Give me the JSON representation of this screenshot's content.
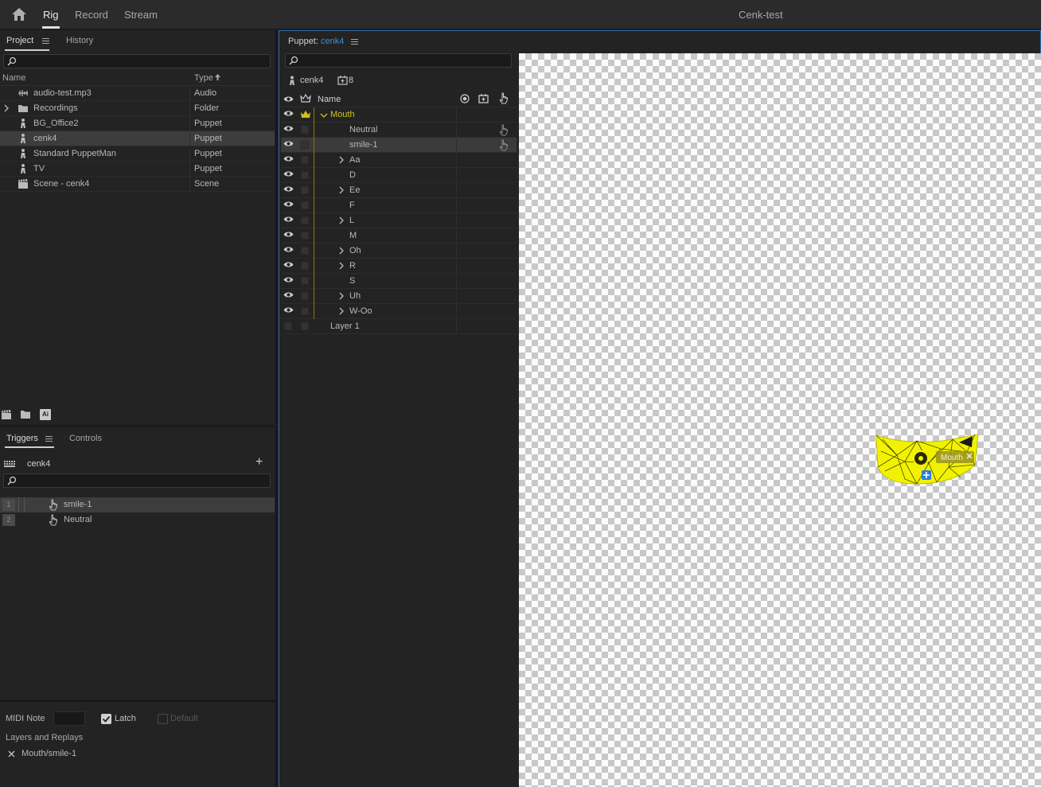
{
  "topbar": {
    "tabs": [
      "Rig",
      "Record",
      "Stream"
    ],
    "active_tab": "Rig",
    "title": "Cenk-test"
  },
  "project": {
    "tab_project": "Project",
    "tab_history": "History",
    "search_placeholder": "",
    "columns": {
      "name": "Name",
      "type": "Type"
    },
    "items": [
      {
        "name": "audio-test.mp3",
        "type": "Audio",
        "icon": "audio-icon"
      },
      {
        "name": "Recordings",
        "type": "Folder",
        "icon": "folder-icon",
        "expandable": true
      },
      {
        "name": "BG_Office2",
        "type": "Puppet",
        "icon": "puppet-icon"
      },
      {
        "name": "cenk4",
        "type": "Puppet",
        "icon": "puppet-icon",
        "selected": true
      },
      {
        "name": "Standard PuppetMan",
        "type": "Puppet",
        "icon": "puppet-icon"
      },
      {
        "name": "TV",
        "type": "Puppet",
        "icon": "puppet-icon"
      },
      {
        "name": "Scene - cenk4",
        "type": "Scene",
        "icon": "scene-icon"
      }
    ],
    "footer": {
      "ai_badge": "Ai"
    }
  },
  "triggers": {
    "tab_triggers": "Triggers",
    "tab_controls": "Controls",
    "puppet_name": "cenk4",
    "add_symbol": "+",
    "items": [
      {
        "num": "1",
        "label": "smile-1",
        "selected": true
      },
      {
        "num": "2",
        "label": "Neutral"
      }
    ]
  },
  "trigger_props": {
    "midi_label": "MIDI Note",
    "midi_value": "",
    "latch_label": "Latch",
    "latch_checked": true,
    "default_label": "Default",
    "default_checked": false,
    "layers_label": "Layers and Replays",
    "layer_entry": "Mouth/smile-1"
  },
  "puppet": {
    "title_prefix": "Puppet:",
    "title_name": "cenk4",
    "puppet_name": "cenk4",
    "badge_count": "8",
    "name_header": "Name",
    "layers": [
      {
        "name": "Mouth",
        "group": true,
        "expanded": true,
        "indent": 0,
        "crown": true,
        "color": "#d4c01e"
      },
      {
        "name": "Neutral",
        "indent": 1,
        "hand": true
      },
      {
        "name": "smile-1",
        "indent": 1,
        "hand": true,
        "selected": true
      },
      {
        "name": "Aa",
        "indent": 1,
        "group": true
      },
      {
        "name": "D",
        "indent": 1
      },
      {
        "name": "Ee",
        "indent": 1,
        "group": true
      },
      {
        "name": "F",
        "indent": 1
      },
      {
        "name": "L",
        "indent": 1,
        "group": true
      },
      {
        "name": "M",
        "indent": 1
      },
      {
        "name": "Oh",
        "indent": 1,
        "group": true
      },
      {
        "name": "R",
        "indent": 1,
        "group": true
      },
      {
        "name": "S",
        "indent": 1
      },
      {
        "name": "Uh",
        "indent": 1,
        "group": true
      },
      {
        "name": "W-Oo",
        "indent": 1,
        "group": true
      },
      {
        "name": "Layer 1",
        "indent": 0,
        "noeye": true
      }
    ],
    "canvas_handle_label": "Mouth"
  },
  "colors": {
    "accent_blue": "#3c8fe0",
    "crown_yellow": "#d4c01e",
    "mesh_yellow": "#f2f200"
  }
}
